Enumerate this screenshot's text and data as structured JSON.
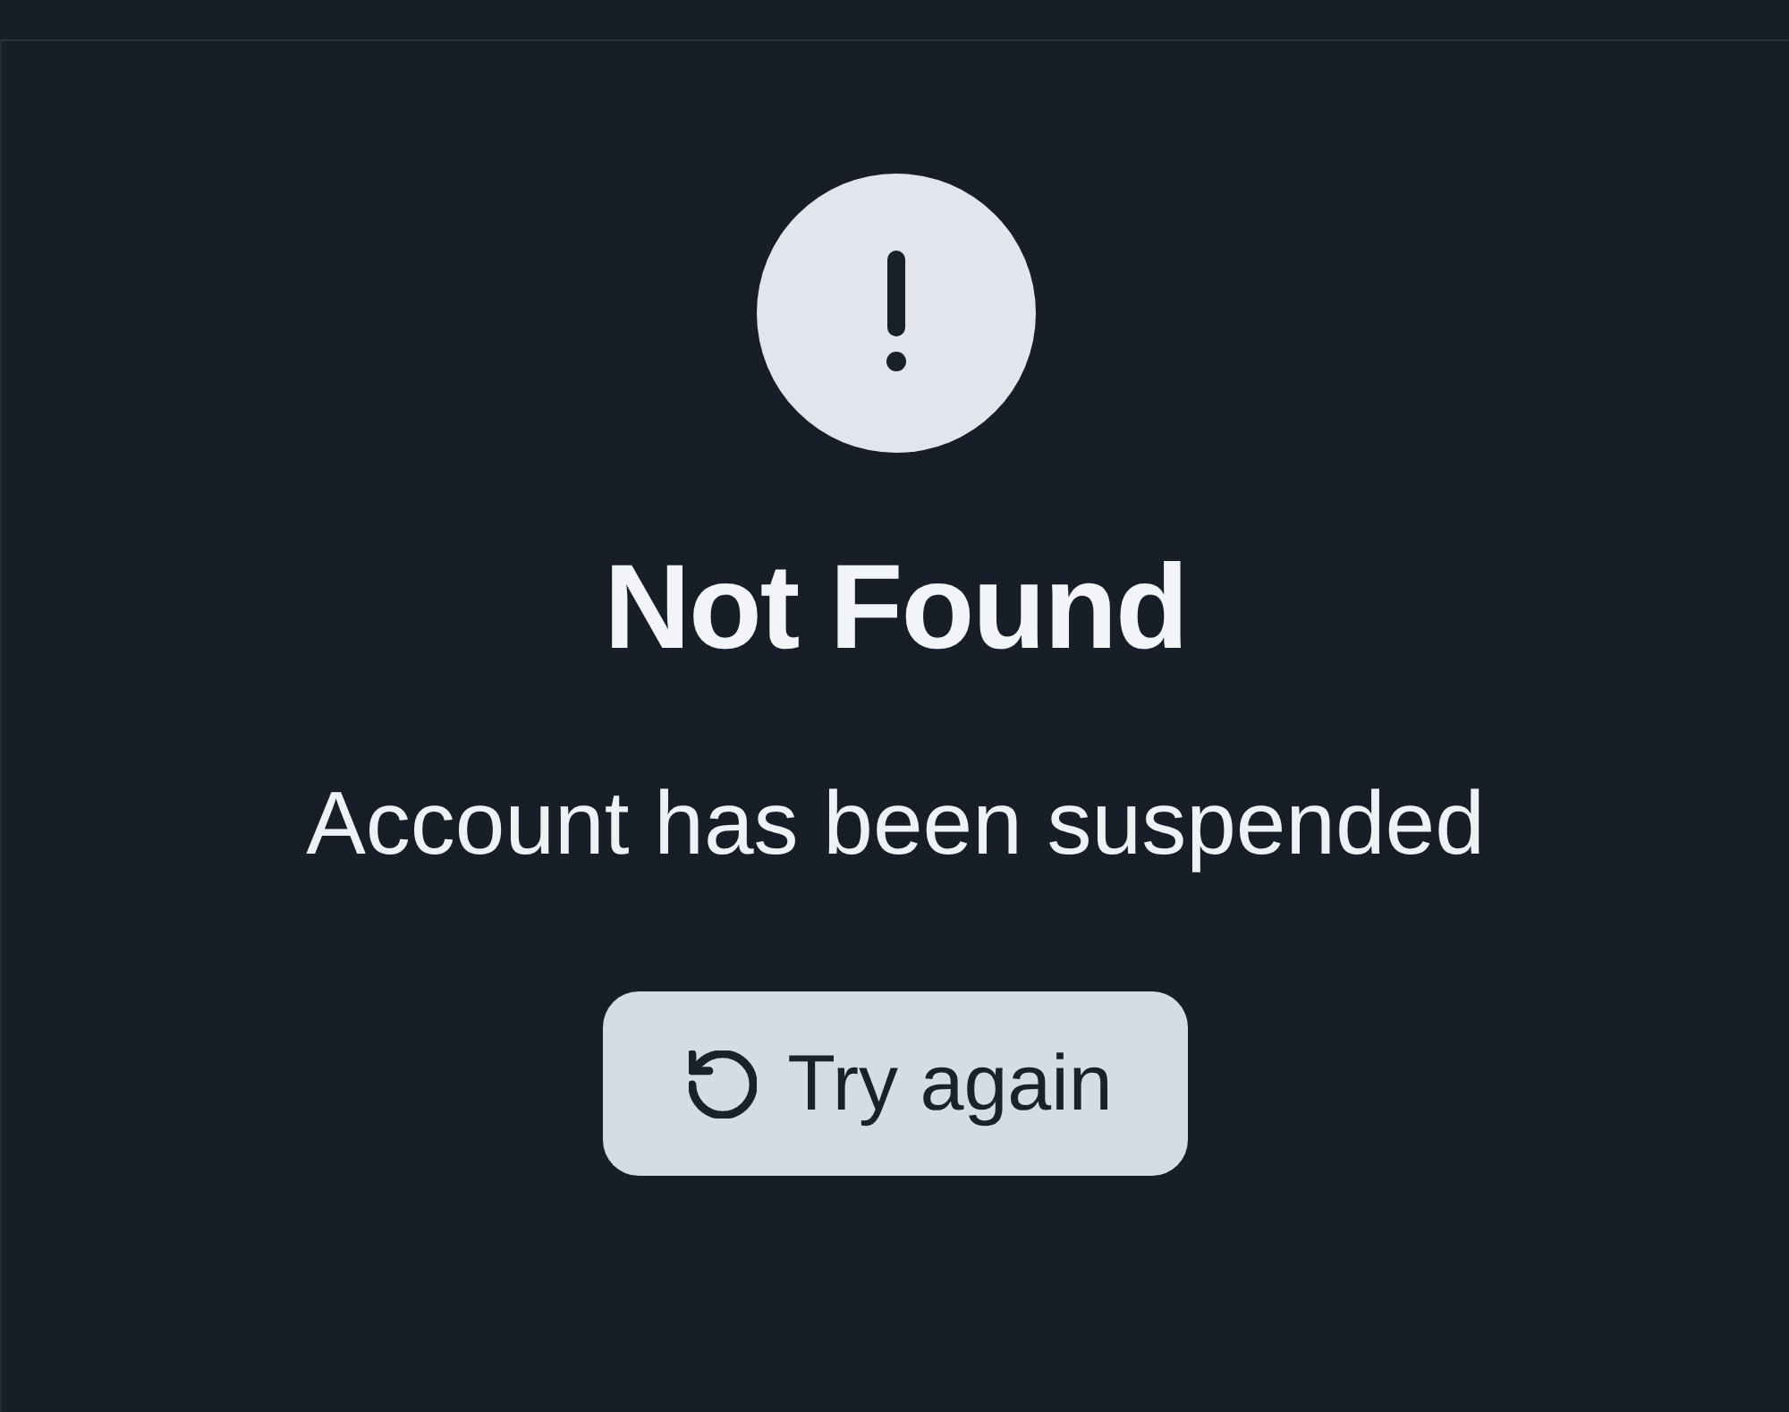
{
  "error": {
    "title": "Not Found",
    "message": "Account has been suspended",
    "action": {
      "label": "Try again"
    }
  }
}
